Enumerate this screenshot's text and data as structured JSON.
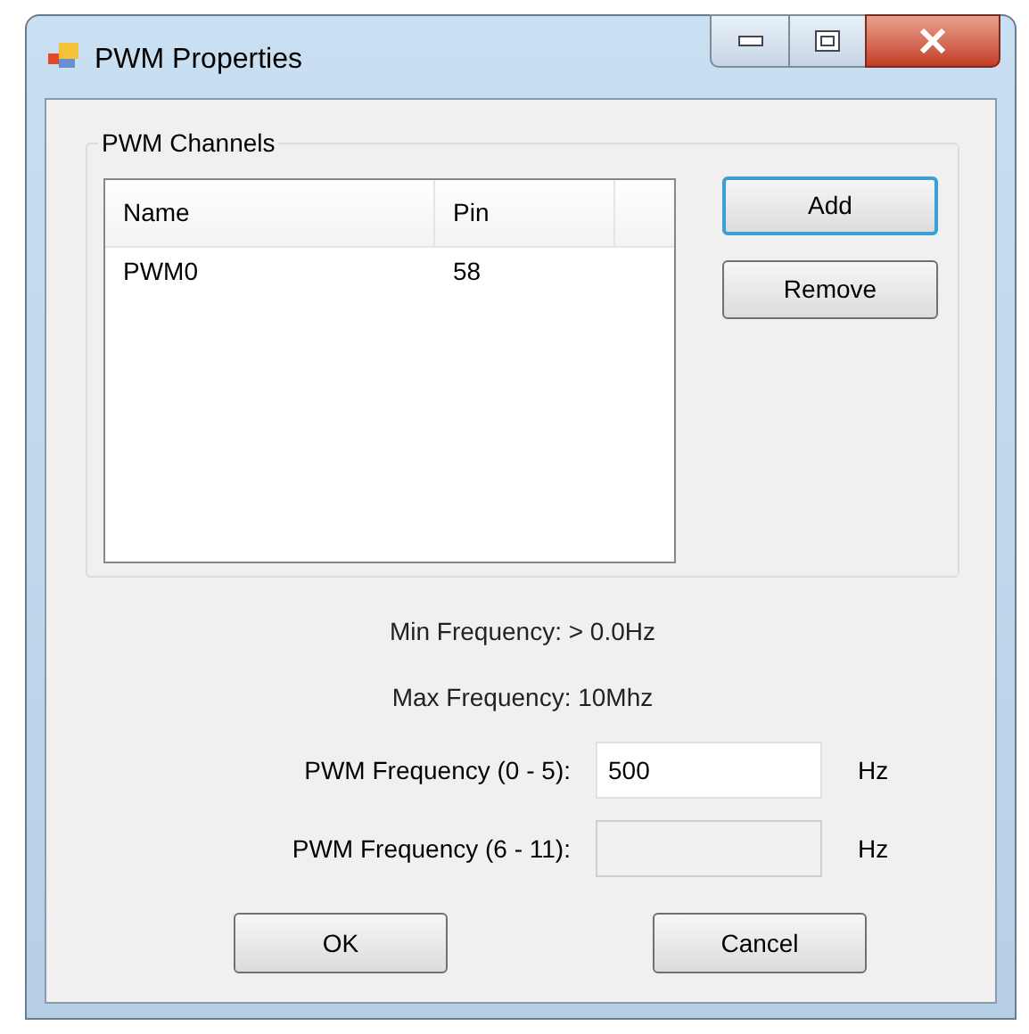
{
  "window": {
    "title": "PWM Properties"
  },
  "group": {
    "title": "PWM Channels"
  },
  "table": {
    "columns": [
      "Name",
      "Pin"
    ],
    "rows": [
      [
        "PWM0",
        "58"
      ]
    ]
  },
  "side_buttons": [
    {
      "label": "Add",
      "default": true
    },
    {
      "label": "Remove",
      "default": false
    }
  ],
  "info": [
    "Min Frequency: > 0.0Hz",
    "Max Frequency: 10Mhz"
  ],
  "fields": [
    {
      "label": "PWM Frequency (0 - 5):",
      "value": "500",
      "unit": "Hz",
      "disabled": false
    },
    {
      "label": "PWM Frequency (6 - 11):",
      "unit": "Hz",
      "disabled": true
    }
  ],
  "buttons": [
    "OK",
    "Cancel"
  ]
}
